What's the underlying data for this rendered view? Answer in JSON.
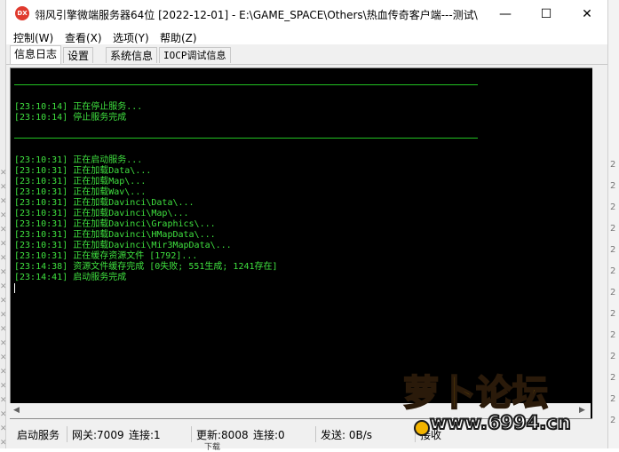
{
  "window": {
    "title": "翎风引擎微端服务器64位 [2022-12-01] - E:\\GAME_SPACE\\Others\\热血传奇客户端---测试\\",
    "app_icon_text": "DX",
    "minimize_glyph": "—",
    "maximize_glyph": "☐",
    "close_glyph": "✕"
  },
  "menu": [
    "控制(W)",
    "查看(X)",
    "选项(Y)",
    "帮助(Z)"
  ],
  "tabs": [
    {
      "label": "信息日志",
      "active": true
    },
    {
      "label": "设置",
      "active": false
    },
    {
      "label": "系统信息",
      "active": false
    },
    {
      "label": "IOCP调试信息",
      "active": false
    }
  ],
  "log": {
    "group1": [
      "[23:10:14] 正在停止服务...",
      "[23:10:14] 停止服务完成"
    ],
    "group2": [
      "[23:10:31] 正在启动服务...",
      "[23:10:31] 正在加载Data\\...",
      "[23:10:31] 正在加载Map\\...",
      "[23:10:31] 正在加载Wav\\...",
      "[23:10:31] 正在加载Davinci\\Data\\...",
      "[23:10:31] 正在加载Davinci\\Map\\...",
      "[23:10:31] 正在加载Davinci\\Graphics\\...",
      "[23:10:31] 正在加载Davinci\\HMapData\\...",
      "[23:10:31] 正在加载Davinci\\Mir3MapData\\...",
      "[23:10:31] 正在缓存资源文件 [1792]...",
      "[23:14:38] 资源文件缓存完成 [0失败; 551生成; 1241存在]",
      "[23:14:41] 启动服务完成"
    ]
  },
  "scrollbar": {
    "left_arrow": "◀",
    "right_arrow": "▶"
  },
  "status": {
    "state": "启动服务",
    "gateway": "网关:7009",
    "gateway_conn": "连接:1",
    "update": "更新:8008",
    "update_conn": "连接:0",
    "send": "发送: 0B/s",
    "recv": "接收"
  },
  "watermark": {
    "title": "萝卜论坛",
    "url": "www.6994.cn"
  },
  "background": {
    "left_glyphs": [
      "✕",
      "✕",
      "✕",
      "✕",
      "✕",
      "✕",
      "✕",
      "✕",
      "✕",
      "✕",
      "✕",
      "✕",
      "✕",
      "✕",
      "✕",
      "✕",
      "✕",
      "✕",
      "✕",
      "✕"
    ],
    "right_glyphs": [
      "2",
      "2",
      "2",
      "2",
      "2",
      "2",
      "2",
      "2",
      "2",
      "2",
      "2",
      "2",
      "2"
    ],
    "bottom_text": "下载"
  },
  "colors": {
    "console_bg": "#000000",
    "console_text": "#3fe03f",
    "accent_icon": "#e03a2e"
  }
}
